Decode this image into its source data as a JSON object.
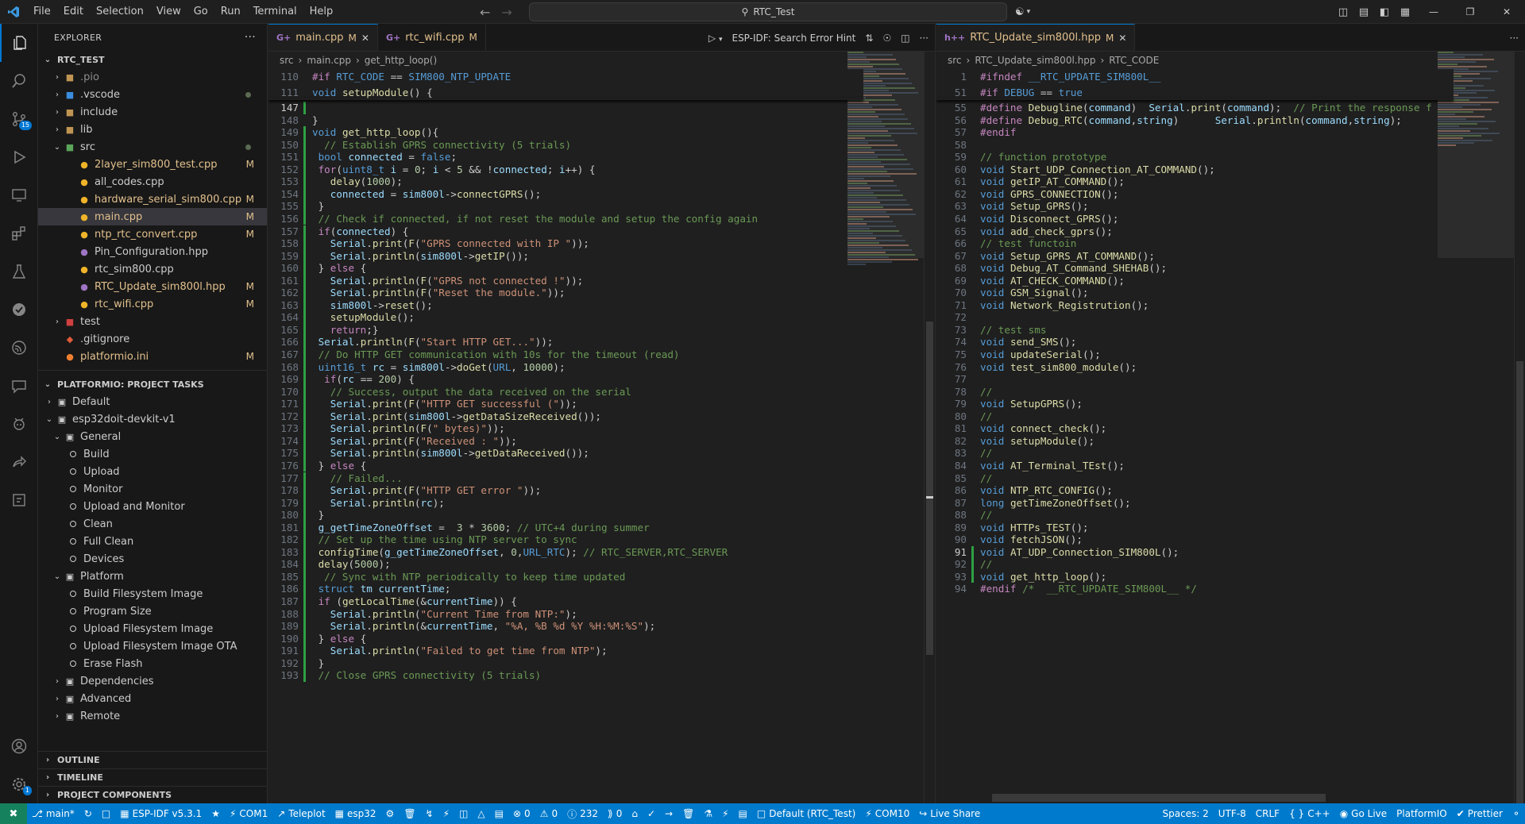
{
  "titlebar": {
    "menu": [
      "File",
      "Edit",
      "Selection",
      "View",
      "Go",
      "Run",
      "Terminal",
      "Help"
    ],
    "search_text": "RTC_Test",
    "back_icon": "arrow-left-icon",
    "forward_icon": "arrow-right-icon"
  },
  "explorer": {
    "title": "EXPLORER",
    "more": "···",
    "project": "RTC_TEST",
    "items": [
      {
        "label": ".pio",
        "type": "folder",
        "depth": 1,
        "collapsed": true,
        "status": ""
      },
      {
        "label": ".vscode",
        "type": "folder",
        "depth": 1,
        "collapsed": true,
        "status": "dot"
      },
      {
        "label": "include",
        "type": "folder",
        "depth": 1,
        "collapsed": true,
        "status": ""
      },
      {
        "label": "lib",
        "type": "folder",
        "depth": 1,
        "collapsed": true,
        "status": ""
      },
      {
        "label": "src",
        "type": "folder",
        "depth": 1,
        "collapsed": false,
        "status": "dot"
      },
      {
        "label": "2layer_sim800_test.cpp",
        "type": "cpp",
        "depth": 2,
        "status": "M"
      },
      {
        "label": "all_codes.cpp",
        "type": "cpp",
        "depth": 2,
        "status": ""
      },
      {
        "label": "hardware_serial_sim800.cpp",
        "type": "cpp",
        "depth": 2,
        "status": "M"
      },
      {
        "label": "main.cpp",
        "type": "cpp",
        "depth": 2,
        "status": "M",
        "selected": true
      },
      {
        "label": "ntp_rtc_convert.cpp",
        "type": "cpp",
        "depth": 2,
        "status": "M"
      },
      {
        "label": "Pin_Configuration.hpp",
        "type": "hpp",
        "depth": 2,
        "status": ""
      },
      {
        "label": "rtc_sim800.cpp",
        "type": "cpp",
        "depth": 2,
        "status": ""
      },
      {
        "label": "RTC_Update_sim800l.hpp",
        "type": "hpp",
        "depth": 2,
        "status": "M"
      },
      {
        "label": "rtc_wifi.cpp",
        "type": "cpp",
        "depth": 2,
        "status": "M"
      },
      {
        "label": "test",
        "type": "folder",
        "depth": 1,
        "collapsed": true,
        "status": ""
      },
      {
        "label": ".gitignore",
        "type": "git",
        "depth": 1,
        "status": ""
      },
      {
        "label": "platformio.ini",
        "type": "ini",
        "depth": 1,
        "status": "M"
      }
    ]
  },
  "platformio": {
    "title": "PLATFORMIO: PROJECT TASKS",
    "rows": [
      {
        "label": "Default",
        "kind": "env",
        "depth": 0,
        "collapsed": true
      },
      {
        "label": "esp32doit-devkit-v1",
        "kind": "env",
        "depth": 0,
        "collapsed": false
      },
      {
        "label": "General",
        "kind": "group",
        "depth": 1,
        "collapsed": false
      },
      {
        "label": "Build",
        "kind": "task",
        "depth": 2
      },
      {
        "label": "Upload",
        "kind": "task",
        "depth": 2
      },
      {
        "label": "Monitor",
        "kind": "task",
        "depth": 2
      },
      {
        "label": "Upload and Monitor",
        "kind": "task",
        "depth": 2
      },
      {
        "label": "Clean",
        "kind": "task",
        "depth": 2
      },
      {
        "label": "Full Clean",
        "kind": "task",
        "depth": 2
      },
      {
        "label": "Devices",
        "kind": "task",
        "depth": 2
      },
      {
        "label": "Platform",
        "kind": "group",
        "depth": 1,
        "collapsed": false
      },
      {
        "label": "Build Filesystem Image",
        "kind": "task",
        "depth": 2
      },
      {
        "label": "Program Size",
        "kind": "task",
        "depth": 2
      },
      {
        "label": "Upload Filesystem Image",
        "kind": "task",
        "depth": 2
      },
      {
        "label": "Upload Filesystem Image OTA",
        "kind": "task",
        "depth": 2
      },
      {
        "label": "Erase Flash",
        "kind": "task",
        "depth": 2
      },
      {
        "label": "Dependencies",
        "kind": "group",
        "depth": 1,
        "collapsed": true
      },
      {
        "label": "Advanced",
        "kind": "group",
        "depth": 1,
        "collapsed": true
      },
      {
        "label": "Remote",
        "kind": "group",
        "depth": 1,
        "collapsed": true
      }
    ]
  },
  "bottom_sections": [
    "OUTLINE",
    "TIMELINE",
    "PROJECT COMPONENTS"
  ],
  "editor_left": {
    "tabs": [
      {
        "label": "main.cpp",
        "status": "M",
        "active": true,
        "closable": true
      },
      {
        "label": "rtc_wifi.cpp",
        "status": "M",
        "active": false,
        "closable": false
      }
    ],
    "action_label": "ESP-IDF: Search Error Hint",
    "breadcrumb": [
      "src",
      "main.cpp",
      "get_http_loop()"
    ],
    "sticky": [
      {
        "n": "110",
        "code": "#if RTC_CODE == SIM800_NTP_UPDATE"
      },
      {
        "n": "111",
        "code": "void setupModule() {"
      }
    ],
    "lines": [
      {
        "n": "147",
        "code": ""
      },
      {
        "n": "148",
        "code": "}"
      },
      {
        "n": "149",
        "code": "void get_http_loop(){"
      },
      {
        "n": "150",
        "code": "  // Establish GPRS connectivity (5 trials)"
      },
      {
        "n": "151",
        "code": " bool connected = false;"
      },
      {
        "n": "152",
        "code": " for(uint8_t i = 0; i < 5 && !connected; i++) {"
      },
      {
        "n": "153",
        "code": "   delay(1000);"
      },
      {
        "n": "154",
        "code": "   connected = sim800l->connectGPRS();"
      },
      {
        "n": "155",
        "code": " }"
      },
      {
        "n": "156",
        "code": " // Check if connected, if not reset the module and setup the config again"
      },
      {
        "n": "157",
        "code": " if(connected) {"
      },
      {
        "n": "158",
        "code": "   Serial.print(F(\"GPRS connected with IP \"));"
      },
      {
        "n": "159",
        "code": "   Serial.println(sim800l->getIP());"
      },
      {
        "n": "160",
        "code": " } else {"
      },
      {
        "n": "161",
        "code": "   Serial.println(F(\"GPRS not connected !\"));"
      },
      {
        "n": "162",
        "code": "   Serial.println(F(\"Reset the module.\"));"
      },
      {
        "n": "163",
        "code": "   sim800l->reset();"
      },
      {
        "n": "164",
        "code": "   setupModule();"
      },
      {
        "n": "165",
        "code": "   return;}"
      },
      {
        "n": "166",
        "code": " Serial.println(F(\"Start HTTP GET...\"));"
      },
      {
        "n": "167",
        "code": " // Do HTTP GET communication with 10s for the timeout (read)"
      },
      {
        "n": "168",
        "code": " uint16_t rc = sim800l->doGet(URL, 10000);"
      },
      {
        "n": "169",
        "code": "  if(rc == 200) {"
      },
      {
        "n": "170",
        "code": "   // Success, output the data received on the serial"
      },
      {
        "n": "171",
        "code": "   Serial.print(F(\"HTTP GET successful (\"));"
      },
      {
        "n": "172",
        "code": "   Serial.print(sim800l->getDataSizeReceived());"
      },
      {
        "n": "173",
        "code": "   Serial.println(F(\" bytes)\"));"
      },
      {
        "n": "174",
        "code": "   Serial.print(F(\"Received : \"));"
      },
      {
        "n": "175",
        "code": "   Serial.println(sim800l->getDataReceived());"
      },
      {
        "n": "176",
        "code": " } else {"
      },
      {
        "n": "177",
        "code": "   // Failed..."
      },
      {
        "n": "178",
        "code": "   Serial.print(F(\"HTTP GET error \"));"
      },
      {
        "n": "179",
        "code": "   Serial.println(rc);"
      },
      {
        "n": "180",
        "code": " }"
      },
      {
        "n": "181",
        "code": " g_getTimeZoneOffset =  3 * 3600; // UTC+4 during summer"
      },
      {
        "n": "182",
        "code": " // Set up the time using NTP server to sync"
      },
      {
        "n": "183",
        "code": " configTime(g_getTimeZoneOffset, 0,URL_RTC); // RTC_SERVER,RTC_SERVER"
      },
      {
        "n": "184",
        "code": " delay(5000);"
      },
      {
        "n": "185",
        "code": "  // Sync with NTP periodically to keep time updated"
      },
      {
        "n": "186",
        "code": " struct tm currentTime;"
      },
      {
        "n": "187",
        "code": " if (getLocalTime(&currentTime)) {"
      },
      {
        "n": "188",
        "code": "   Serial.println(\"Current Time from NTP:\");"
      },
      {
        "n": "189",
        "code": "   Serial.println(&currentTime, \"%A, %B %d %Y %H:%M:%S\");"
      },
      {
        "n": "190",
        "code": " } else {"
      },
      {
        "n": "191",
        "code": "   Serial.println(\"Failed to get time from NTP\");"
      },
      {
        "n": "192",
        "code": " }"
      },
      {
        "n": "193",
        "code": " // Close GPRS connectivity (5 trials)"
      }
    ]
  },
  "editor_right": {
    "tabs": [
      {
        "label": "RTC_Update_sim800l.hpp",
        "status": "M",
        "active": true,
        "closable": true
      }
    ],
    "breadcrumb": [
      "src",
      "RTC_Update_sim800l.hpp",
      "RTC_CODE"
    ],
    "sticky": [
      {
        "n": "1",
        "code": "#ifndef __RTC_UPDATE_SIM800L__"
      },
      {
        "n": "51",
        "code": "#if DEBUG == true"
      }
    ],
    "lines": [
      {
        "n": "55",
        "code": "#define Debugline(command)  Serial.print(command);  // Print the response f"
      },
      {
        "n": "56",
        "code": "#define Debug_RTC(command,string)      Serial.println(command,string);"
      },
      {
        "n": "57",
        "code": "#endif"
      },
      {
        "n": "58",
        "code": ""
      },
      {
        "n": "59",
        "code": "// function prototype"
      },
      {
        "n": "60",
        "code": "void Start_UDP_Connection_AT_COMMAND();"
      },
      {
        "n": "61",
        "code": "void getIP_AT_COMMAND();"
      },
      {
        "n": "62",
        "code": "void GPRS_CONNECTION();"
      },
      {
        "n": "63",
        "code": "void Setup_GPRS();"
      },
      {
        "n": "64",
        "code": "void Disconnect_GPRS();"
      },
      {
        "n": "65",
        "code": "void add_check_gprs();"
      },
      {
        "n": "66",
        "code": "// test functoin"
      },
      {
        "n": "67",
        "code": "void Setup_GPRS_AT_COMMAND();"
      },
      {
        "n": "68",
        "code": "void Debug_AT_Command_SHEHAB();"
      },
      {
        "n": "69",
        "code": "void AT_CHECK_COMMAND();"
      },
      {
        "n": "70",
        "code": "void GSM_Signal();"
      },
      {
        "n": "71",
        "code": "void Network_Registrution();"
      },
      {
        "n": "72",
        "code": ""
      },
      {
        "n": "73",
        "code": "// test sms"
      },
      {
        "n": "74",
        "code": "void send_SMS();"
      },
      {
        "n": "75",
        "code": "void updateSerial();"
      },
      {
        "n": "76",
        "code": "void test_sim800_module();"
      },
      {
        "n": "77",
        "code": ""
      },
      {
        "n": "78",
        "code": "//"
      },
      {
        "n": "79",
        "code": "void SetupGPRS();"
      },
      {
        "n": "80",
        "code": "//"
      },
      {
        "n": "81",
        "code": "void connect_check();"
      },
      {
        "n": "82",
        "code": "void setupModule();"
      },
      {
        "n": "83",
        "code": "//"
      },
      {
        "n": "84",
        "code": "void AT_Terminal_TEst();"
      },
      {
        "n": "85",
        "code": "//"
      },
      {
        "n": "86",
        "code": "void NTP_RTC_CONFIG();"
      },
      {
        "n": "87",
        "code": "long getTimeZoneOffset();"
      },
      {
        "n": "88",
        "code": "//"
      },
      {
        "n": "89",
        "code": "void HTTPs_TEST();"
      },
      {
        "n": "90",
        "code": "void fetchJSON();"
      },
      {
        "n": "91",
        "code": "void AT_UDP_Connection_SIM800L();"
      },
      {
        "n": "92",
        "code": "//"
      },
      {
        "n": "93",
        "code": "void get_http_loop();"
      },
      {
        "n": "94",
        "code": "#endif /*  __RTC_UPDATE_SIM800L__ */"
      }
    ]
  },
  "statusbar": {
    "left": [
      {
        "icon": "branch-icon",
        "text": "main*"
      },
      {
        "icon": "sync-icon",
        "text": ""
      },
      {
        "icon": "folder-icon",
        "text": ""
      },
      {
        "icon": "chip-icon",
        "text": "ESP-IDF v5.3.1"
      },
      {
        "icon": "star-icon",
        "text": ""
      },
      {
        "icon": "plug-icon",
        "text": "COM1"
      },
      {
        "icon": "graph-icon",
        "text": "Teleplot"
      },
      {
        "icon": "chip-icon",
        "text": "esp32"
      },
      {
        "icon": "gear-icon",
        "text": ""
      },
      {
        "icon": "trash-icon",
        "text": ""
      },
      {
        "icon": "wrench-icon",
        "text": ""
      },
      {
        "icon": "bolt-icon",
        "text": ""
      },
      {
        "icon": "monitor-icon",
        "text": ""
      },
      {
        "icon": "flame-icon",
        "text": ""
      },
      {
        "icon": "terminal-icon",
        "text": ""
      },
      {
        "icon": "error-icon",
        "text": "0"
      },
      {
        "icon": "warning-icon",
        "text": "0"
      },
      {
        "icon": "info-icon",
        "text": "232"
      },
      {
        "icon": "ports-icon",
        "text": "0"
      },
      {
        "icon": "home-icon",
        "text": ""
      },
      {
        "icon": "check-icon",
        "text": ""
      },
      {
        "icon": "arrow-right-icon",
        "text": ""
      },
      {
        "icon": "trash-icon",
        "text": ""
      },
      {
        "icon": "flask-icon",
        "text": ""
      },
      {
        "icon": "plug-icon",
        "text": ""
      },
      {
        "icon": "terminal-icon",
        "text": ""
      },
      {
        "icon": "folder-icon",
        "text": "Default (RTC_Test)"
      },
      {
        "icon": "plug-icon",
        "text": "COM10"
      },
      {
        "icon": "liveshare-icon",
        "text": "Live Share"
      }
    ],
    "right": [
      {
        "icon": "",
        "text": "Spaces: 2"
      },
      {
        "icon": "",
        "text": "UTF-8"
      },
      {
        "icon": "",
        "text": "CRLF"
      },
      {
        "icon": "braces-icon",
        "text": "C++"
      },
      {
        "icon": "broadcast-icon",
        "text": "Go Live"
      },
      {
        "icon": "",
        "text": "PlatformIO"
      },
      {
        "icon": "prettier-icon",
        "text": "Prettier"
      },
      {
        "icon": "bell-icon",
        "text": ""
      }
    ]
  }
}
